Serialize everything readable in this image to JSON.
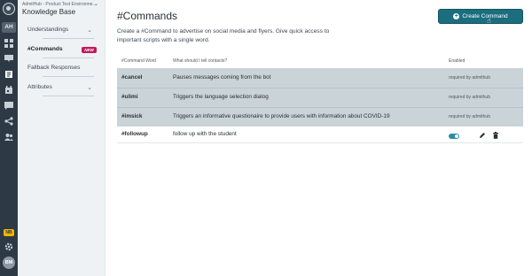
{
  "rail": {
    "org_initials": "AH",
    "beta_badge": "NB",
    "user_initials": "BM",
    "icons": [
      "logo-icon",
      "dashboard-icon",
      "inbox-icon",
      "knowledge-base-icon",
      "calendar-icon",
      "messages-icon",
      "flow-icon",
      "contacts-icon",
      "settings-icon"
    ]
  },
  "sidebar": {
    "environment": "AdmitHub - Product Test Environme...",
    "title": "Knowledge Base",
    "items": [
      {
        "label": "Understandings"
      },
      {
        "label": "#Commands",
        "badge": "NEW"
      },
      {
        "label": "Fallback Responses"
      },
      {
        "label": "Attributes"
      }
    ]
  },
  "main": {
    "title": "#Commands",
    "create_button": "Create Command",
    "description": "Create a #Command to advertise on social media and flyers. Give quick access to important scripts with a single word.",
    "columns": [
      "#Command Word",
      "What should I tell contacts?",
      "Enabled"
    ],
    "rows": [
      {
        "word": "#cancel",
        "reply": "Pauses messages coming from the bot",
        "status": "required by admithub"
      },
      {
        "word": "#ulimi",
        "reply": "Triggers the language selection dialog",
        "status": "required by admithub"
      },
      {
        "word": "#imsick",
        "reply": "Triggers an informative questionaire to provide users with information about COVID-19",
        "status": "required by admithub"
      },
      {
        "word": "#followup",
        "reply": "follow up with the student",
        "enabled": true
      }
    ]
  }
}
